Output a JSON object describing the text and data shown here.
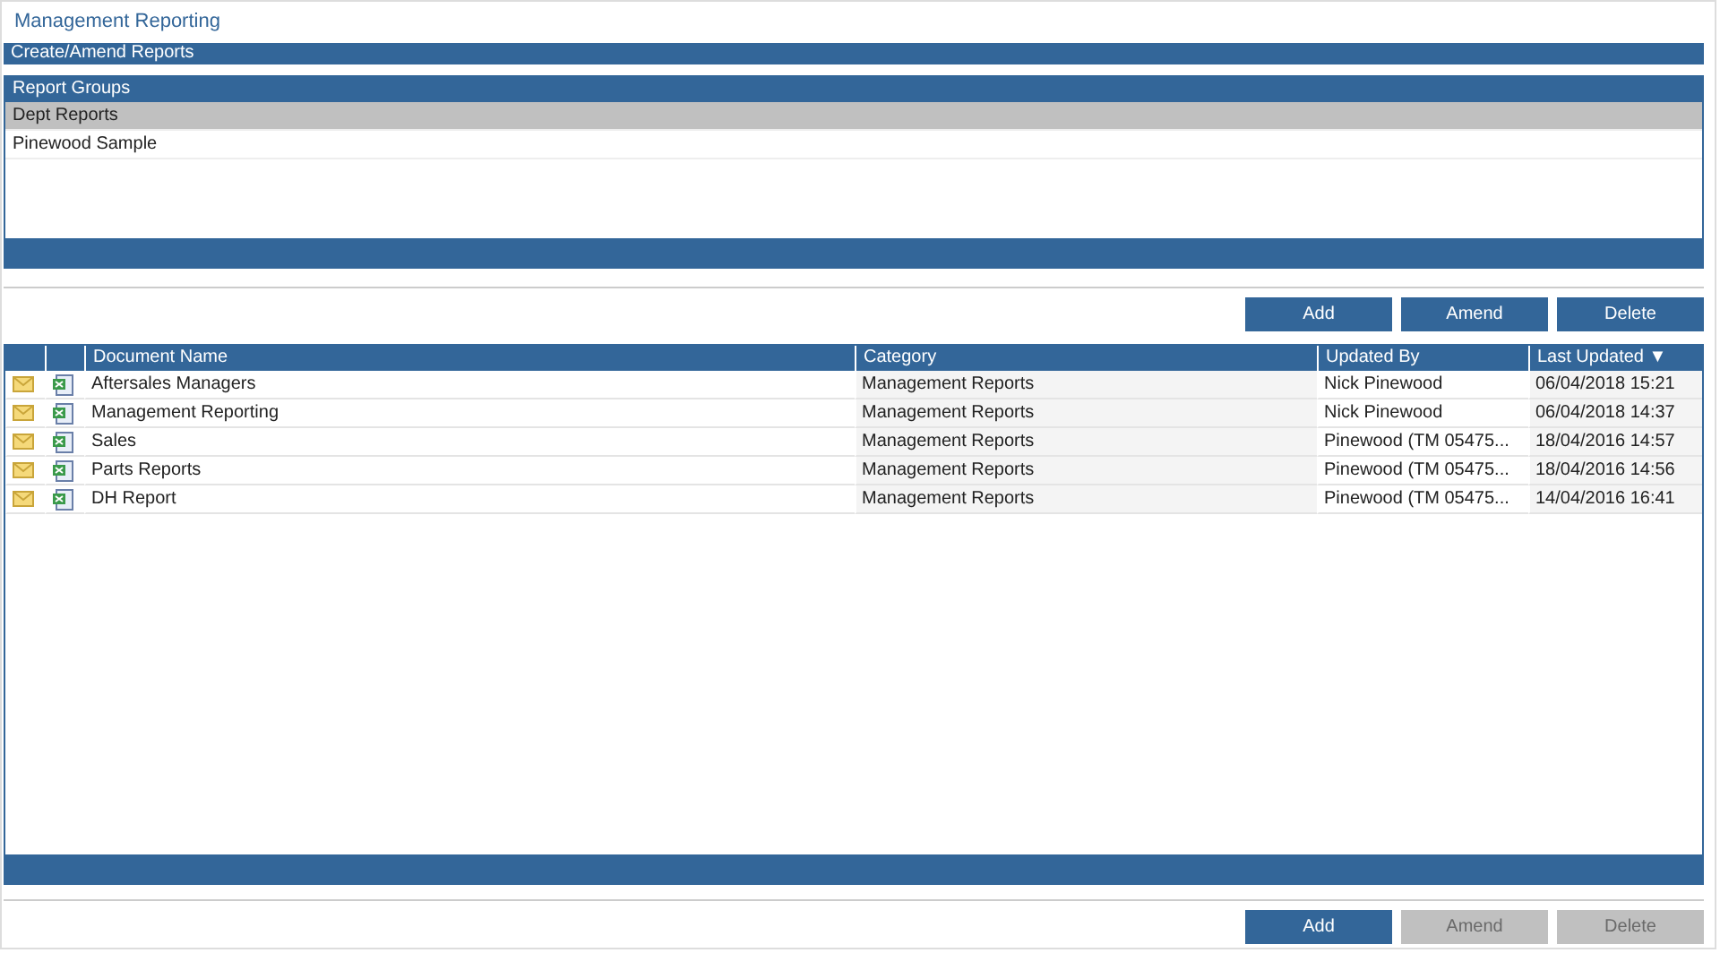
{
  "title": "Management Reporting",
  "section_header": "Create/Amend Reports",
  "report_groups": {
    "heading": "Report Groups",
    "items": [
      {
        "label": "Dept Reports",
        "selected": true
      },
      {
        "label": "Pinewood Sample",
        "selected": false
      }
    ]
  },
  "group_buttons": [
    {
      "label": "Add",
      "disabled": false
    },
    {
      "label": "Amend",
      "disabled": false
    },
    {
      "label": "Delete",
      "disabled": false
    }
  ],
  "documents": {
    "columns": [
      "Document Name",
      "Category",
      "Updated By",
      "Last Updated ▼"
    ],
    "rows": [
      {
        "name": "Aftersales Managers",
        "category": "Management Reports",
        "updated_by": "Nick Pinewood",
        "last_updated": "06/04/2018 15:21"
      },
      {
        "name": "Management Reporting",
        "category": "Management Reports",
        "updated_by": "Nick Pinewood",
        "last_updated": "06/04/2018 14:37"
      },
      {
        "name": "Sales",
        "category": "Management Reports",
        "updated_by": "Pinewood (TM 05475...",
        "last_updated": "18/04/2016 14:57"
      },
      {
        "name": "Parts Reports",
        "category": "Management Reports",
        "updated_by": "Pinewood (TM 05475...",
        "last_updated": "18/04/2016 14:56"
      },
      {
        "name": "DH Report",
        "category": "Management Reports",
        "updated_by": "Pinewood (TM 05475...",
        "last_updated": "14/04/2016 16:41"
      }
    ]
  },
  "document_buttons": [
    {
      "label": "Add",
      "disabled": false
    },
    {
      "label": "Amend",
      "disabled": true
    },
    {
      "label": "Delete",
      "disabled": true
    }
  ]
}
